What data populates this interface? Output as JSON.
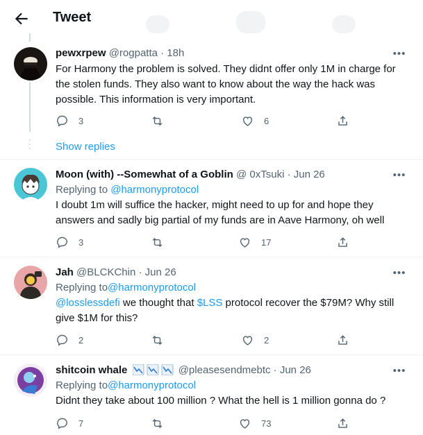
{
  "header": {
    "title": "Tweet",
    "back_icon": "arrow-left-icon"
  },
  "colors": {
    "link": "#1d9bf0",
    "muted": "#536471",
    "text": "#0f1419",
    "divider": "#eff3f4",
    "thread_line": "#cfd9de"
  },
  "thread": {
    "show_replies_label": "Show replies"
  },
  "tweets": [
    {
      "name": "pewxrpew",
      "handle": "@rogpatta · 18h",
      "text": "For Harmony the problem is solved. They didnt offer only 1M in charge for the stolen funds. They also want to know about the way the hack was possible. This information is very important.",
      "replies": "3",
      "retweets": "",
      "likes": "6"
    },
    {
      "name": "Moon (with) --Somewhat of a Goblin",
      "handle": "@ 0xTsuki · Jun 26",
      "replying_prefix": "Replying to ",
      "replying_to": "@harmonyprotocol",
      "text": "I doubt 1m will suffice the hacker, might need to up for and hope they answers and sadly big partial of my funds are in Aave Harmony, oh well",
      "replies": "3",
      "retweets": "",
      "likes": "17"
    },
    {
      "name": "Jah",
      "handle": "@BLCKChin · Jun 26",
      "replying_prefix": "Replying to",
      "replying_to": "@harmonyprotocol",
      "mention": "@losslessdefi",
      "text_a": " we thought that ",
      "cashtag": "$LSS",
      "text_b": " protocol recover the $79M? Why still give $1M for this?",
      "replies": "2",
      "retweets": "",
      "likes": "2"
    },
    {
      "name": "shitcoin whale",
      "handle": "@pleasesendmebtc · Jun 26",
      "replying_prefix": "Replying to",
      "replying_to": "@harmonyprotocol",
      "text": "Didnt they take about 100 million ? What the hell is 1 million gonna do ?",
      "replies": "7",
      "retweets": "",
      "likes": "73"
    }
  ]
}
